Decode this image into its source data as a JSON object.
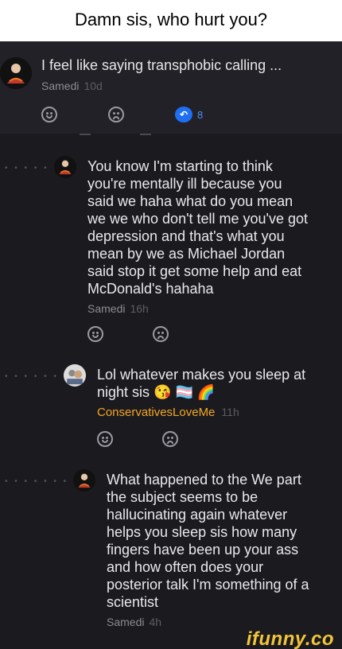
{
  "caption": "Damn sis, who hurt you?",
  "post": {
    "title": "I feel like saying transphobic calling ...",
    "author": "Samedi",
    "age": "10d",
    "reply_count": "8",
    "reply_icon_glyph": "↶"
  },
  "comments": [
    {
      "text_lines": [
        "You know I'm starting to think",
        "you're mentally ill because you",
        "said we haha what do you mean",
        "we we who don't tell me you've got",
        "depression and that's what you",
        "mean by we as Michael Jordan",
        "said stop it get some help and eat",
        "McDonald's hahaha"
      ],
      "author": "Samedi",
      "age": "16h",
      "thread_dots": "• • • • •"
    },
    {
      "text_lines": [
        "Lol whatever makes you sleep at",
        "night sis 😘 🏳️‍⚧️ 🌈"
      ],
      "author": "ConservativesLoveMe",
      "age": "11h",
      "author_color": "#f5a623",
      "thread_dots": "• • • • • •"
    },
    {
      "text_lines": [
        "What happened to the We part",
        "the subject seems to be",
        "hallucinating again whatever",
        "helps you sleep sis how many",
        "fingers have been up your ass",
        "and how often does your",
        "posterior talk I'm something of a",
        "scientist"
      ],
      "author": "Samedi",
      "age": "4h",
      "thread_dots": "• • • • • • •"
    }
  ],
  "icons": {
    "reaction_like": "smile-reaction-icon",
    "reaction_dislike": "frown-reaction-icon",
    "replies": "comment-bubble-icon"
  },
  "watermark": "ifunny.co"
}
